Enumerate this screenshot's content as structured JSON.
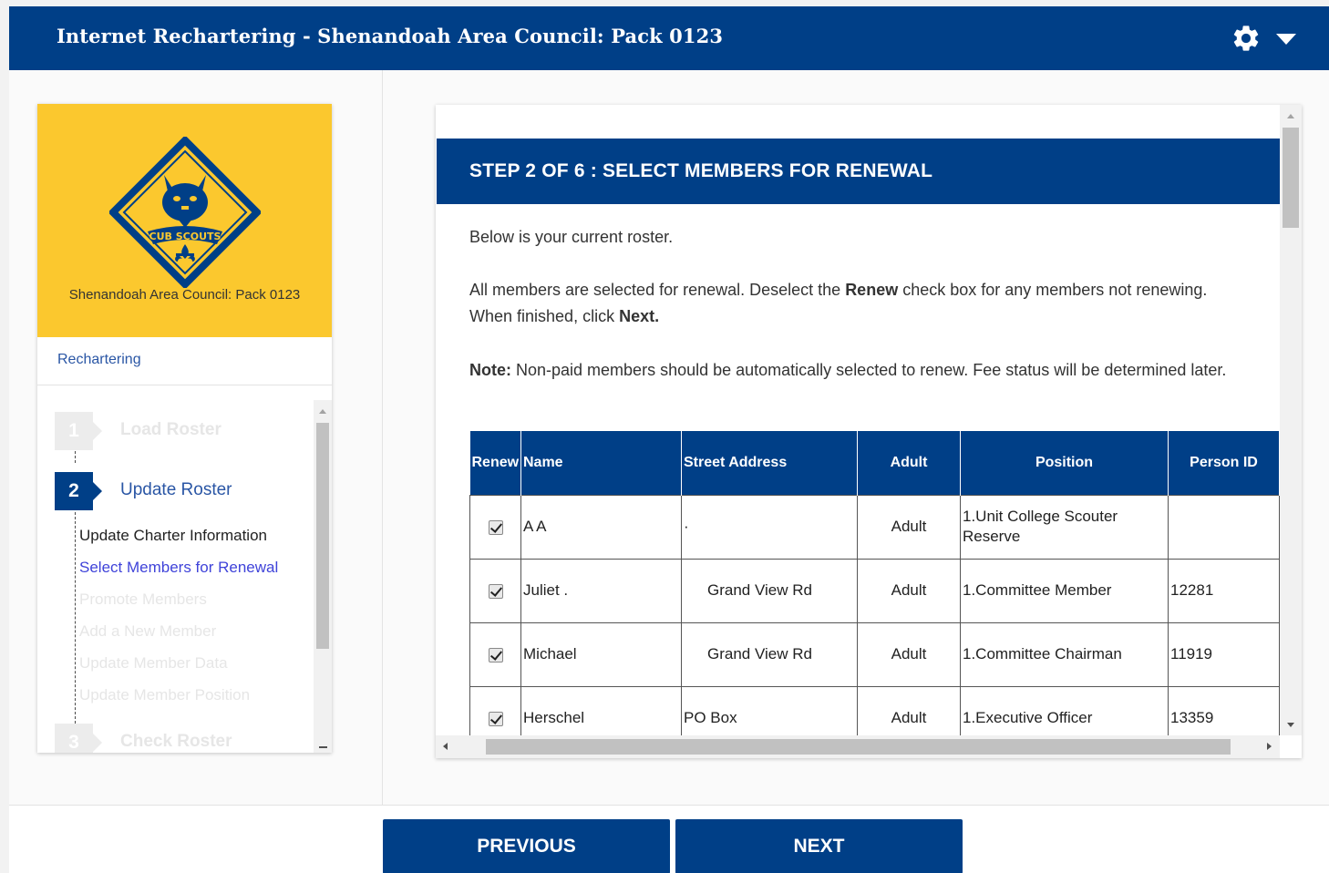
{
  "app": {
    "title": "Internet Rechartering - Shenandoah Area Council: Pack 0123",
    "settings_icon": "gear-icon",
    "menu_icon": "caret-down-icon"
  },
  "sidebar": {
    "logo_text": "CUB SCOUTS",
    "unit_name": "Shenandoah Area Council: Pack 0123",
    "section_link": "Rechartering",
    "steps": [
      {
        "number": "1",
        "label": "Load Roster",
        "state": "inactive"
      },
      {
        "number": "2",
        "label": "Update Roster",
        "state": "active",
        "substeps": [
          {
            "label": "Update Charter Information",
            "state": "done"
          },
          {
            "label": "Select Members for Renewal",
            "state": "current"
          },
          {
            "label": "Promote Members",
            "state": "todo"
          },
          {
            "label": "Add a New Member",
            "state": "todo"
          },
          {
            "label": "Update Member Data",
            "state": "todo"
          },
          {
            "label": "Update Member Position",
            "state": "todo"
          }
        ]
      },
      {
        "number": "3",
        "label": "Check Roster",
        "state": "inactive"
      }
    ]
  },
  "main": {
    "step_title": "STEP 2 OF 6 : SELECT MEMBERS FOR RENEWAL",
    "intro": "Below is your current roster.",
    "instruction_pre": "All members are selected for renewal. Deselect the ",
    "instruction_bold1": "Renew",
    "instruction_mid": " check box for any members not renewing. When finished, click ",
    "instruction_bold2": "Next.",
    "note_label": "Note:",
    "note_text": " Non-paid members should be automatically selected to renew. Fee status will be determined later.",
    "table": {
      "columns": [
        "Renew",
        "Name",
        "Street Address",
        "Adult",
        "Position",
        "Person ID"
      ],
      "rows": [
        {
          "renew": true,
          "name": "A A",
          "address": "·",
          "adult": "Adult",
          "position": "1.Unit College Scouter Reserve",
          "person_id": ""
        },
        {
          "renew": true,
          "name": "Juliet .",
          "address": "Grand View Rd",
          "adult": "Adult",
          "position": "1.Committee Member",
          "person_id": "12281"
        },
        {
          "renew": true,
          "name": "Michael",
          "address": "Grand View Rd",
          "adult": "Adult",
          "position": "1.Committee Chairman",
          "person_id": "11919"
        },
        {
          "renew": true,
          "name": "Herschel",
          "address": "PO Box",
          "adult": "Adult",
          "position": "1.Executive Officer",
          "person_id": "13359"
        }
      ]
    }
  },
  "footer": {
    "previous_label": "PREVIOUS",
    "next_label": "NEXT"
  },
  "colors": {
    "brand_blue": "#003f87",
    "cub_yellow": "#fbc82e",
    "link_blue": "#2a56a5",
    "current_substep": "#3f43d9"
  }
}
